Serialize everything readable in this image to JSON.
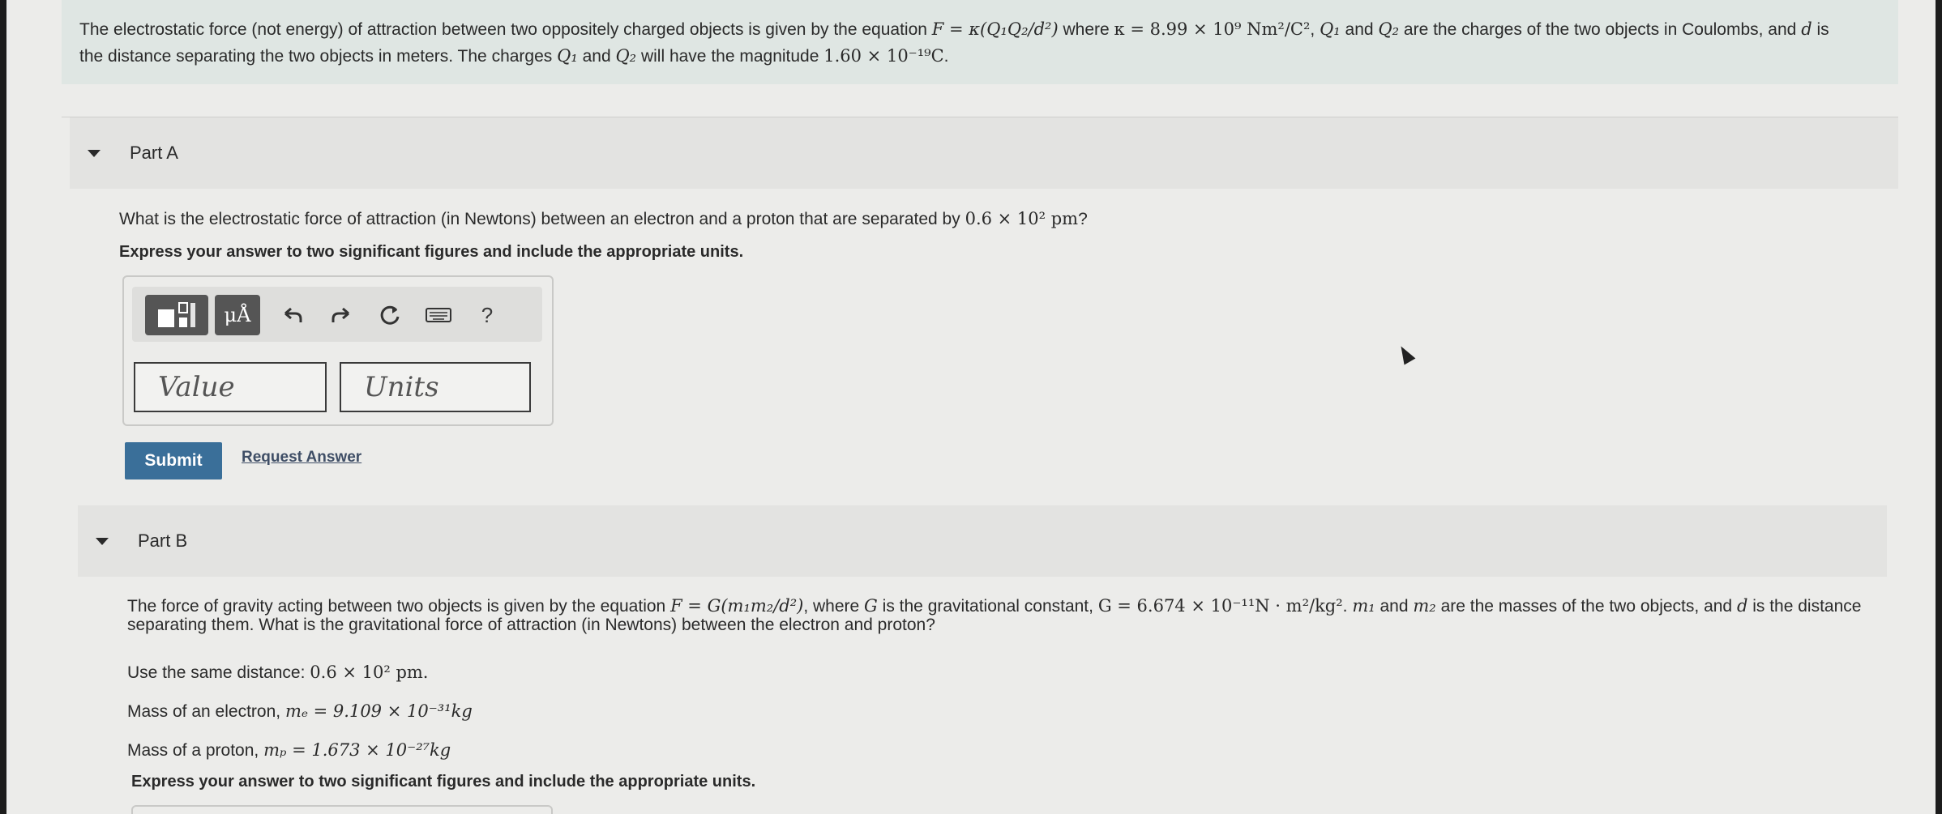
{
  "intro": {
    "t1": "The electrostatic force (not energy) of attraction between two oppositely charged objects is given by the equation ",
    "eq_F": "F = κ(Q₁Q₂/d²)",
    "t2": " where ",
    "eq_k": "κ = 8.99 × 10⁹ Nm²/C²",
    "t3": ", ",
    "q1": "Q₁",
    "t4": " and ",
    "q2": "Q₂",
    "t5": " are the charges of the two objects in Coulombs, and ",
    "d": "d",
    "t6": " is",
    "line2_t1": "the distance separating the two objects in meters. The charges ",
    "line2_q1": "Q₁",
    "line2_t2": " and ",
    "line2_q2": "Q₂",
    "line2_t3": " will have the magnitude ",
    "line2_val": "1.60 × 10⁻¹⁹C",
    "line2_end": "."
  },
  "partA": {
    "title": "Part A",
    "question": "What is the electrostatic force of attraction (in Newtons) between an electron and a proton that are separated by ",
    "question_val": "0.6 × 10² pm",
    "question_end": "?",
    "instruction": "Express your answer to two significant figures and include the appropriate units.",
    "value_placeholder": "Value",
    "units_placeholder": "Units",
    "submit_label": "Submit",
    "request_label": "Request Answer",
    "toolbar": {
      "units_btn": "μÅ",
      "help": "?"
    }
  },
  "partB": {
    "title": "Part B",
    "line1_t1": "The force of gravity acting between two objects is given by the equation ",
    "line1_eq": "F = G(m₁m₂/d²)",
    "line1_t2": ", where ",
    "line1_G": "G",
    "line1_t3": " is the gravitational constant, ",
    "line1_Gval": "G = 6.674 × 10⁻¹¹N · m²/kg²",
    "line1_t4": ". ",
    "line1_m1": "m₁",
    "line1_t5": " and ",
    "line1_m2": "m₂",
    "line1_t6": " are the masses of the two objects, and ",
    "line1_d": "d",
    "line1_t7": " is the distance",
    "line2": "separating them. What is the gravitational force of attraction (in Newtons) between the electron and proton?",
    "distance_label": "Use the same distance: ",
    "distance_val": "0.6 × 10² pm.",
    "electron_label": "Mass of an electron, ",
    "electron_val": "mₑ = 9.109 × 10⁻³¹kg",
    "proton_label": "Mass of a proton, ",
    "proton_val": "mₚ = 1.673 × 10⁻²⁷kg",
    "instruction": "Express your answer to two significant figures and include the appropriate units."
  }
}
